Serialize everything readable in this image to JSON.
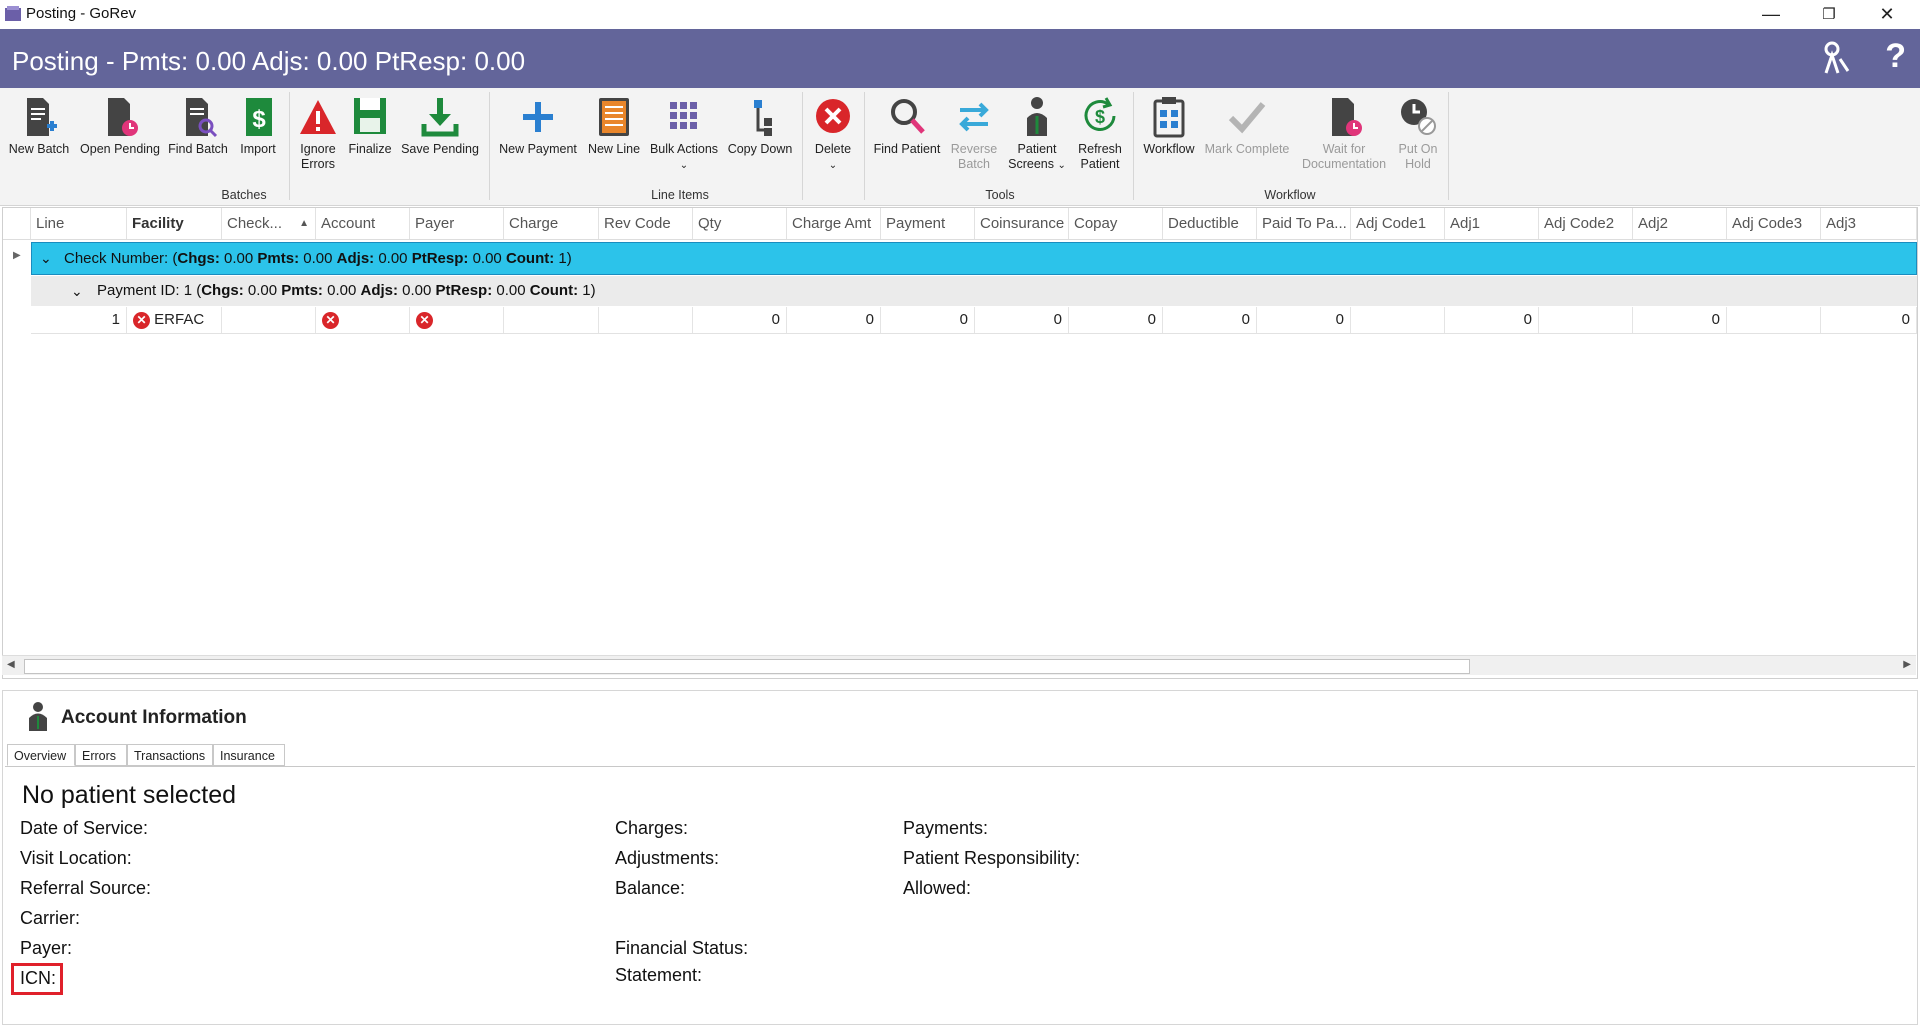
{
  "window": {
    "title": "Posting - GoRev",
    "minimize": "—",
    "restore": "❐",
    "close": "✕"
  },
  "header": {
    "title": "Posting - Pmts: 0.00 Adjs: 0.00 PtResp: 0.00",
    "help": "?"
  },
  "ribbon": {
    "groups": [
      "Batches",
      "Line Items",
      "Tools",
      "Workflow"
    ],
    "buttons": {
      "new_batch": "New Batch",
      "open_pending": "Open Pending",
      "find_batch": "Find Batch",
      "import": "Import",
      "ignore_errors": "Ignore Errors",
      "finalize": "Finalize",
      "save_pending": "Save Pending",
      "new_payment": "New Payment",
      "new_line": "New Line",
      "bulk_actions": "Bulk Actions",
      "copy_down": "Copy Down",
      "delete": "Delete",
      "find_patient": "Find Patient",
      "reverse_batch": "Reverse Batch",
      "patient_screens": "Patient Screens",
      "refresh_patient": "Refresh Patient",
      "workflow": "Workflow",
      "mark_complete": "Mark Complete",
      "wait_documentation": "Wait for Documentation",
      "put_on_hold": "Put On Hold"
    }
  },
  "grid": {
    "columns": [
      "Line",
      "Facility",
      "Check...",
      "Account",
      "Payer",
      "Charge",
      "Rev Code",
      "Qty",
      "Charge Amt",
      "Payment",
      "Coinsurance",
      "Copay",
      "Deductible",
      "Paid To Pa...",
      "Adj Code1",
      "Adj1",
      "Adj Code2",
      "Adj2",
      "Adj Code3",
      "Adj3"
    ],
    "group1": {
      "label": "Check Number:",
      "summary_open": "(",
      "chgs_label": "Chgs:",
      "chgs": "0.00",
      "pmts_label": "Pmts:",
      "pmts": "0.00",
      "adjs_label": "Adjs:",
      "adjs": "0.00",
      "ptresp_label": "PtResp:",
      "ptresp": "0.00",
      "count_label": "Count:",
      "count": "1)"
    },
    "group2": {
      "label": "Payment ID: 1 (",
      "chgs_label": "Chgs:",
      "chgs": "0.00",
      "pmts_label": "Pmts:",
      "pmts": "0.00",
      "adjs_label": "Adjs:",
      "adjs": "0.00",
      "ptresp_label": "PtResp:",
      "ptresp": "0.00",
      "count_label": "Count:",
      "count": "1)"
    },
    "row": {
      "line": "1",
      "facility": "ERFAC",
      "qty": "0",
      "charge_amt": "0",
      "payment": "0",
      "coinsurance": "0",
      "copay": "0",
      "deductible": "0",
      "paid_to_pa": "0",
      "adj1": "0",
      "adj2": "0",
      "adj3": "0"
    }
  },
  "account": {
    "title": "Account Information",
    "tabs": [
      "Overview",
      "Errors",
      "Transactions",
      "Insurance"
    ],
    "no_patient": "No patient selected",
    "left": [
      "Date of Service:",
      "Visit Location:",
      "Referral Source:",
      "Carrier:",
      "Payer:",
      "ICN:"
    ],
    "middle": [
      "Charges:",
      "Adjustments:",
      "Balance:",
      "Financial Status:",
      "Statement:"
    ],
    "right": [
      "Payments:",
      "Patient Responsibility:",
      "Allowed:"
    ]
  },
  "colors": {
    "header": "#63659a",
    "group_highlight": "#2cc3ea",
    "error": "#d9262a",
    "icn_highlight": "#e0202a"
  }
}
